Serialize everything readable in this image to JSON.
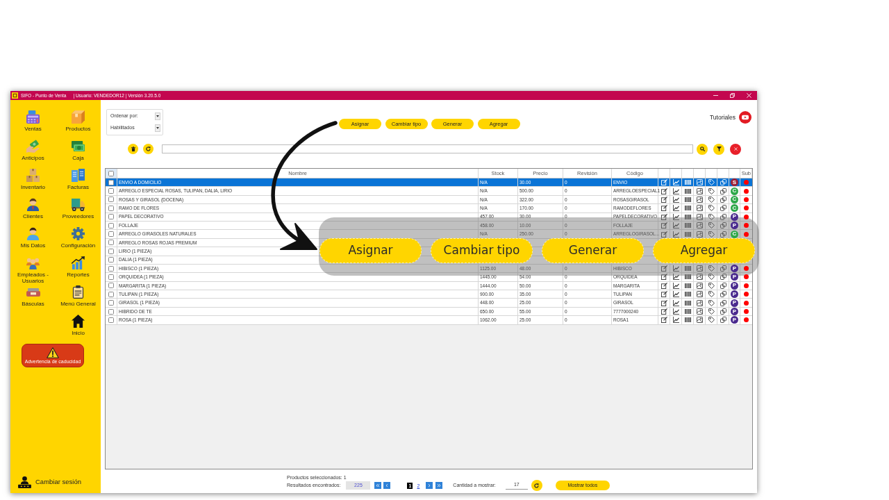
{
  "window": {
    "title": "SIFO - Punto de Venta",
    "session": "| Usuario: VENDEDOR12 | Versión 3.20.5.0"
  },
  "sidebar": {
    "items": [
      "Ventas",
      "Productos",
      "Anticipos",
      "Caja",
      "Inventario",
      "Facturas",
      "Clientes",
      "Proveedores",
      "Mis Datos",
      "Configuración",
      "Empleados - Usuarios",
      "Reportes",
      "Básculas",
      "Menú General",
      "Inicio"
    ],
    "warning_button": "Advertencia de caducidad",
    "session_button": "Cambiar sesión"
  },
  "toolbar": {
    "sort": "Ordenar por:",
    "filter": "Habilitados",
    "actions": [
      "Asignar",
      "Cambiar tipo",
      "Generar",
      "Agregar"
    ],
    "tutorials": "Tutoriales"
  },
  "table": {
    "header_checked": false,
    "columns": {
      "name": "Nombre",
      "stock": "Stock",
      "price": "Precio",
      "revision": "Revisión",
      "code": "Código",
      "sub": "Sub"
    },
    "rows": [
      {
        "checked": false,
        "selected": true,
        "name": "ENVIO A DOMICILIO",
        "stock": "N/A",
        "price": "30.00",
        "revision": "0",
        "code": "ENVIO",
        "actions": true,
        "badge": {
          "letter": "S",
          "color": "#9e1f35"
        },
        "sub": false
      },
      {
        "checked": false,
        "selected": false,
        "name": "ARREGLO ESPECIAL ROSAS, TULIPAN, DALIA, LIRIO",
        "stock": "N/A",
        "price": "500.00",
        "revision": "0",
        "code": "ARREGLOESPECIAL1",
        "actions": true,
        "badge": {
          "letter": "C",
          "color": "#2ea84a"
        },
        "sub": false
      },
      {
        "checked": false,
        "selected": false,
        "name": "ROSAS Y GIRASOL (DOCENA)",
        "stock": "N/A",
        "price": "322.00",
        "revision": "0",
        "code": "ROSASGIRASOL",
        "actions": true,
        "badge": {
          "letter": "C",
          "color": "#2ea84a"
        },
        "sub": false
      },
      {
        "checked": false,
        "selected": false,
        "name": "RAMO DE FLORES",
        "stock": "N/A",
        "price": "170.00",
        "revision": "0",
        "code": "RAMODEFLORES",
        "actions": true,
        "badge": {
          "letter": "C",
          "color": "#2ea84a"
        },
        "sub": false
      },
      {
        "checked": false,
        "selected": false,
        "name": "PAPEL DECORATIVO",
        "stock": "457.00",
        "price": "30.00",
        "revision": "0",
        "code": "PAPELDECORATIVO",
        "actions": true,
        "badge": {
          "letter": "P",
          "color": "#4a2a8e"
        },
        "sub": false
      },
      {
        "checked": false,
        "selected": false,
        "name": "FOLLAJE",
        "stock": "458.00",
        "price": "10.00",
        "revision": "0",
        "code": "FOLLAJE",
        "actions": true,
        "badge": {
          "letter": "P",
          "color": "#4a2a8e"
        },
        "sub": false
      },
      {
        "checked": false,
        "selected": false,
        "name": "ARREGLO GIRASOLES NATURALES",
        "stock": "N/A",
        "price": "250.00",
        "revision": "0",
        "code": "ARREGLOGIRASOL...",
        "actions": true,
        "badge": {
          "letter": "C",
          "color": "#2ea84a"
        },
        "sub": false
      },
      {
        "checked": false,
        "selected": false,
        "name": "ARREGLO ROSAS ROJAS PREMIUM"
      },
      {
        "checked": false,
        "selected": false,
        "name": "LIRIO (1 PIEZA)"
      },
      {
        "checked": false,
        "selected": false,
        "name": "DALIA (1 PIEZA)"
      },
      {
        "checked": false,
        "selected": false,
        "name": "HIBISCO (1 PIEZA)",
        "stock": "1125.00",
        "price": "48.00",
        "revision": "0",
        "code": "HIBISCO",
        "actions": true,
        "badge": {
          "letter": "P",
          "color": "#4a2a8e"
        },
        "sub": false
      },
      {
        "checked": false,
        "selected": false,
        "name": "ORQUIDEA (1 PIEZA)",
        "stock": "1445.00",
        "price": "54.00",
        "revision": "0",
        "code": "ORQUIDEA",
        "actions": true,
        "badge": {
          "letter": "P",
          "color": "#4a2a8e"
        },
        "sub": false
      },
      {
        "checked": false,
        "selected": false,
        "name": "MARGARITA (1 PIEZA)",
        "stock": "1444.00",
        "price": "50.00",
        "revision": "0",
        "code": "MARGARITA",
        "actions": true,
        "badge": {
          "letter": "P",
          "color": "#4a2a8e"
        },
        "sub": false
      },
      {
        "checked": false,
        "selected": false,
        "name": "TULIPAN (1 PIEZA)",
        "stock": "900.00",
        "price": "35.00",
        "revision": "0",
        "code": "TULIPAN",
        "actions": true,
        "badge": {
          "letter": "P",
          "color": "#4a2a8e"
        },
        "sub": false
      },
      {
        "checked": false,
        "selected": false,
        "name": "GIRASOL (1 PIEZA)",
        "stock": "448.00",
        "price": "25.00",
        "revision": "0",
        "code": "GIRASOL",
        "actions": true,
        "badge": {
          "letter": "P",
          "color": "#4a2a8e"
        },
        "sub": false
      },
      {
        "checked": false,
        "selected": false,
        "name": "HIBRIDO DE TE",
        "stock": "650.00",
        "price": "55.00",
        "revision": "0",
        "code": "7777000240",
        "actions": true,
        "badge": {
          "letter": "P",
          "color": "#4a2a8e"
        },
        "sub": false
      },
      {
        "checked": false,
        "selected": false,
        "name": "ROSA (1 PIEZA)",
        "stock": "1062.00",
        "price": "25.00",
        "revision": "0",
        "code": "ROSA1",
        "actions": true,
        "badge": {
          "letter": "P",
          "color": "#4a2a8e"
        },
        "sub": false
      }
    ]
  },
  "footer": {
    "selected_count": "Productos seleccionados: 1",
    "results_label": "Resultados encontrados:",
    "results": "225",
    "pages": [
      {
        "label": "1",
        "selected": true
      },
      {
        "label": "2",
        "selected": false
      }
    ],
    "quantity_label": "Cantidad a mostrar:",
    "quantity": "17",
    "show_all": "Mostrar todos"
  },
  "callout": {
    "buttons": [
      "Asignar",
      "Cambiar tipo",
      "Generar",
      "Agregar"
    ]
  }
}
